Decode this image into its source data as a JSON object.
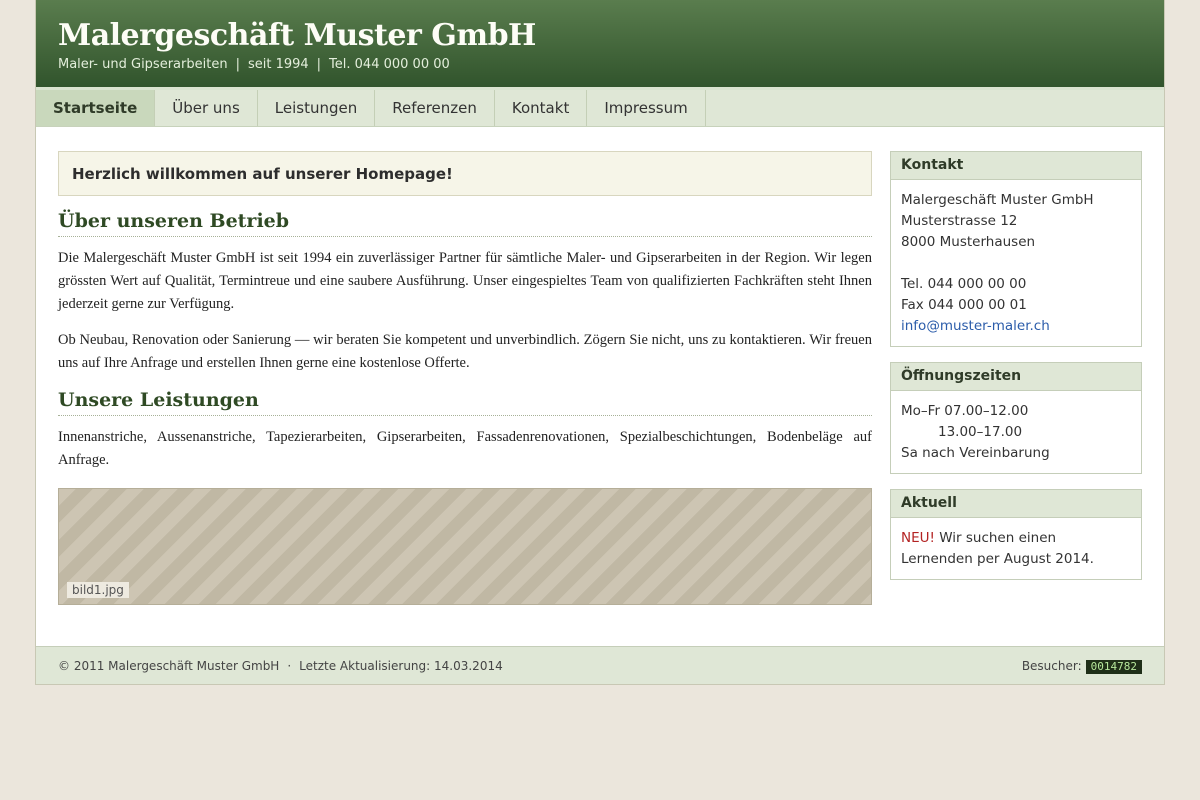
{
  "header": {
    "title": "Malergeschäft Muster GmbH",
    "tagline_parts": [
      "Maler- und Gipserarbeiten",
      "seit 1994",
      "Tel. 044 000 00 00"
    ],
    "separator": "|"
  },
  "nav": {
    "items": [
      {
        "label": "Startseite",
        "active": true
      },
      {
        "label": "Über uns",
        "active": false
      },
      {
        "label": "Leistungen",
        "active": false
      },
      {
        "label": "Referenzen",
        "active": false
      },
      {
        "label": "Kontakt",
        "active": false
      },
      {
        "label": "Impressum",
        "active": false
      }
    ]
  },
  "main": {
    "welcome": "Herzlich willkommen auf unserer Homepage!",
    "section1": {
      "heading": "Über unseren Betrieb",
      "p1": "Die Malergeschäft Muster GmbH ist seit 1994 ein zuverlässiger Partner für sämtliche Maler- und Gipserarbeiten in der Region. Wir legen grössten Wert auf Qualität, Termintreue und eine saubere Ausführung. Unser eingespieltes Team von qualifizierten Fachkräften steht Ihnen jederzeit gerne zur Verfügung.",
      "p2": "Ob Neubau, Renovation oder Sanierung — wir beraten Sie kompetent und unverbindlich. Zögern Sie nicht, uns zu kontaktieren. Wir freuen uns auf Ihre Anfrage und erstellen Ihnen gerne eine kostenlose Offerte."
    },
    "section2": {
      "heading": "Unsere Leistungen",
      "p1": "Innenanstriche, Aussenanstriche, Tapezierarbeiten, Gipserarbeiten, Fassadenrenovationen, Spezialbeschichtungen, Bodenbeläge auf Anfrage."
    },
    "image_label": "bild1.jpg"
  },
  "sidebar": {
    "contact": {
      "title": "Kontakt",
      "company": "Malergeschäft Muster GmbH",
      "street": "Musterstrasse 12",
      "city": "8000 Musterhausen",
      "tel": "Tel. 044 000 00 00",
      "fax": "Fax 044 000 00 01",
      "email": "info@muster-maler.ch"
    },
    "hours": {
      "title": "Öffnungszeiten",
      "line1": "Mo–Fr 07.00–12.00",
      "line2": "13.00–17.00",
      "line3": "Sa nach Vereinbarung"
    },
    "news": {
      "title": "Aktuell",
      "badge": "NEU!",
      "text": " Wir suchen einen Lernenden per August 2014."
    }
  },
  "footer": {
    "copyright": "© 2011 Malergeschäft Muster GmbH",
    "dot": "·",
    "updated": "Letzte Aktualisierung: 14.03.2014",
    "visitors_label": "Besucher:",
    "visitors_count": "0014782"
  },
  "colors": {
    "header_green": "#31542c",
    "nav_bg": "#dfe7d6",
    "link_blue": "#2b5caa",
    "news_red": "#b32323"
  }
}
